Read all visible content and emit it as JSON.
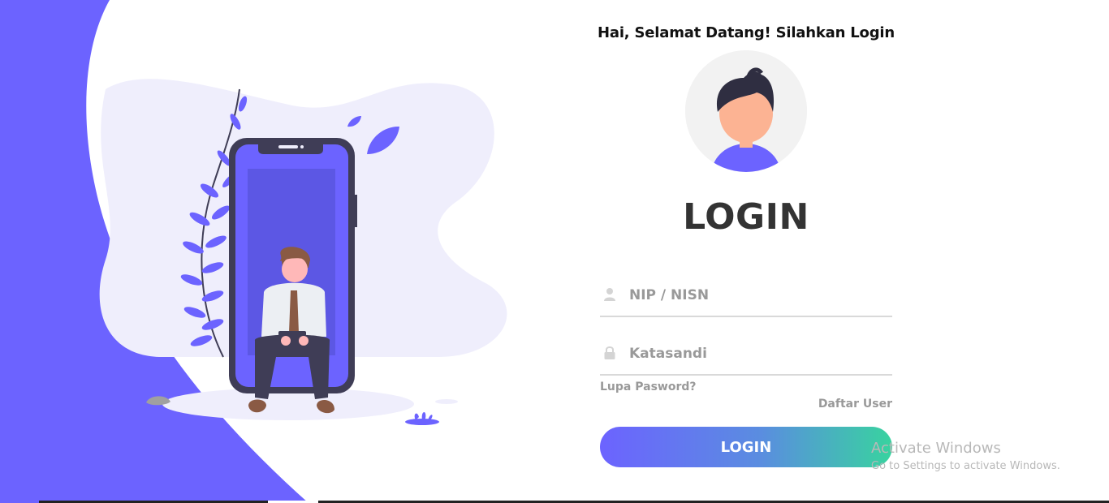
{
  "greeting": "Hai, Selamat Datang! Silahkan Login",
  "login_title": "LOGIN",
  "fields": {
    "nip": {
      "placeholder": "NIP / NISN",
      "value": "",
      "icon": "user-icon"
    },
    "password": {
      "placeholder": "Katasandi",
      "value": "",
      "icon": "lock-icon"
    }
  },
  "links": {
    "forgot_password": "Lupa Pasword?",
    "register": "Daftar User"
  },
  "login_button": "LOGIN",
  "watermark": {
    "title": "Activate Windows",
    "subtitle": "Go to Settings to activate Windows."
  },
  "colors": {
    "accent": "#6c63ff",
    "accent_light": "#efeefc",
    "gradient_end": "#38d39f",
    "text_dark": "#333333",
    "text_muted": "#999999"
  }
}
